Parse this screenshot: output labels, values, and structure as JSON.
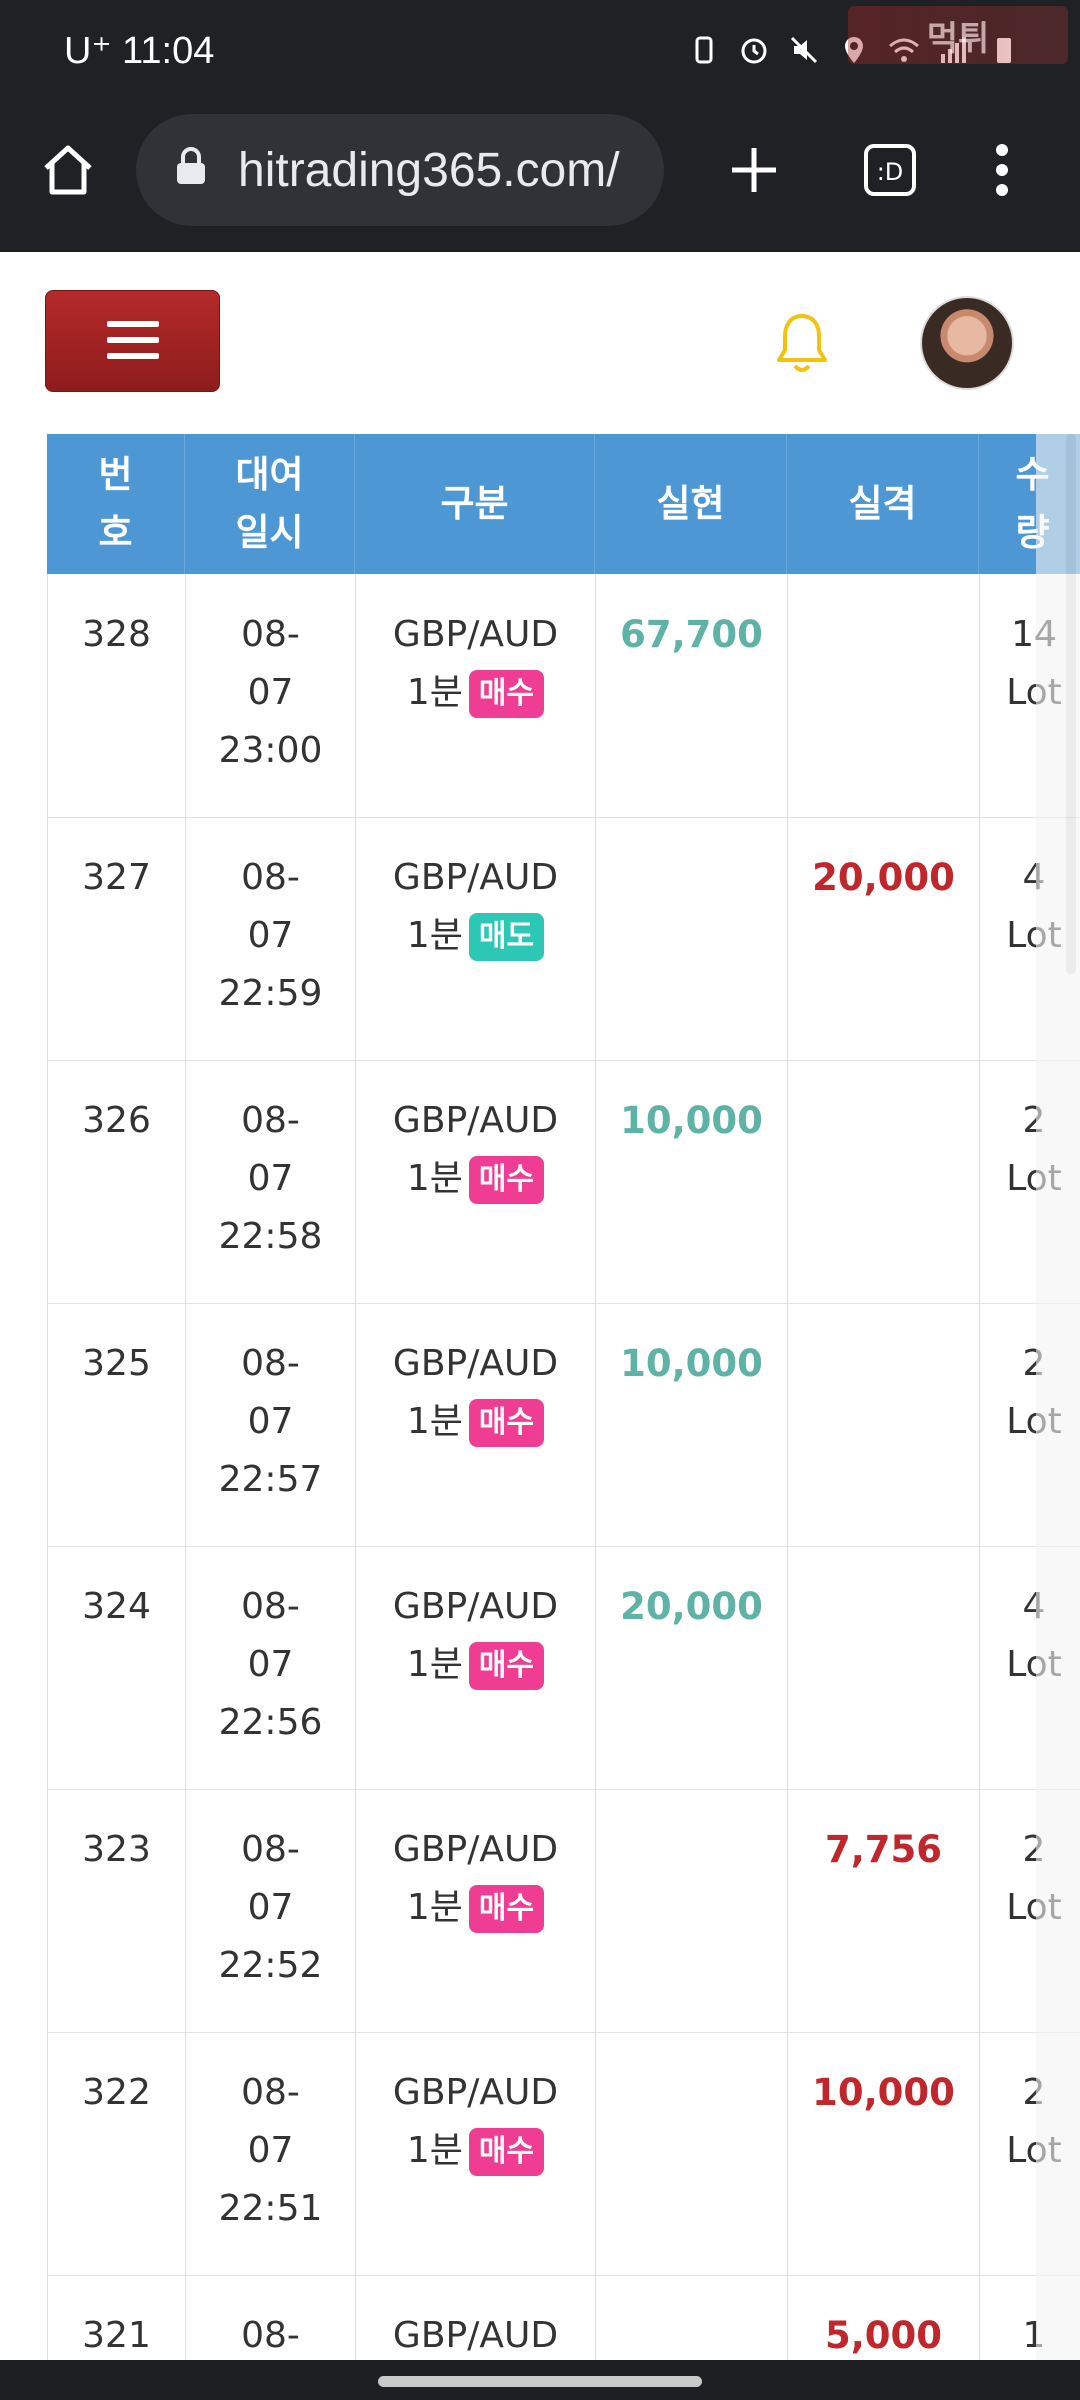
{
  "status_bar": {
    "carrier_time": "U⁺ 11:04",
    "watermark": "먹튀"
  },
  "browser": {
    "url": "hitrading365.com/",
    "tab_switcher_label": ":D"
  },
  "table": {
    "headers": [
      "번\n호",
      "대여\n일시",
      "구분",
      "실현",
      "실격",
      "수\n량"
    ],
    "rows": [
      {
        "no": "328",
        "datetime": "08-\n07\n23:00",
        "pair": "GBP/AUD",
        "period": "1분",
        "side": "매수",
        "side_type": "buy",
        "profit": "67,700",
        "loss": "",
        "qty": "14\nLot"
      },
      {
        "no": "327",
        "datetime": "08-\n07\n22:59",
        "pair": "GBP/AUD",
        "period": "1분",
        "side": "매도",
        "side_type": "sell",
        "profit": "",
        "loss": "20,000",
        "qty": "4\nLot"
      },
      {
        "no": "326",
        "datetime": "08-\n07\n22:58",
        "pair": "GBP/AUD",
        "period": "1분",
        "side": "매수",
        "side_type": "buy",
        "profit": "10,000",
        "loss": "",
        "qty": "2\nLot"
      },
      {
        "no": "325",
        "datetime": "08-\n07\n22:57",
        "pair": "GBP/AUD",
        "period": "1분",
        "side": "매수",
        "side_type": "buy",
        "profit": "10,000",
        "loss": "",
        "qty": "2\nLot"
      },
      {
        "no": "324",
        "datetime": "08-\n07\n22:56",
        "pair": "GBP/AUD",
        "period": "1분",
        "side": "매수",
        "side_type": "buy",
        "profit": "20,000",
        "loss": "",
        "qty": "4\nLot"
      },
      {
        "no": "323",
        "datetime": "08-\n07\n22:52",
        "pair": "GBP/AUD",
        "period": "1분",
        "side": "매수",
        "side_type": "buy",
        "profit": "",
        "loss": "7,756",
        "qty": "2\nLot"
      },
      {
        "no": "322",
        "datetime": "08-\n07\n22:51",
        "pair": "GBP/AUD",
        "period": "1분",
        "side": "매수",
        "side_type": "buy",
        "profit": "",
        "loss": "10,000",
        "qty": "2\nLot"
      },
      {
        "no": "321",
        "datetime": "08-",
        "pair": "GBP/AUD",
        "period": "",
        "side": "",
        "side_type": "",
        "profit": "",
        "loss": "5,000",
        "qty": "1"
      }
    ]
  },
  "colors": {
    "header_blue": "#4d97d5",
    "profit": "#5fb3a6",
    "loss": "#c0272d",
    "buy": "#ef3d93",
    "sell": "#2cc8b5",
    "menu_red": "#a52222"
  }
}
